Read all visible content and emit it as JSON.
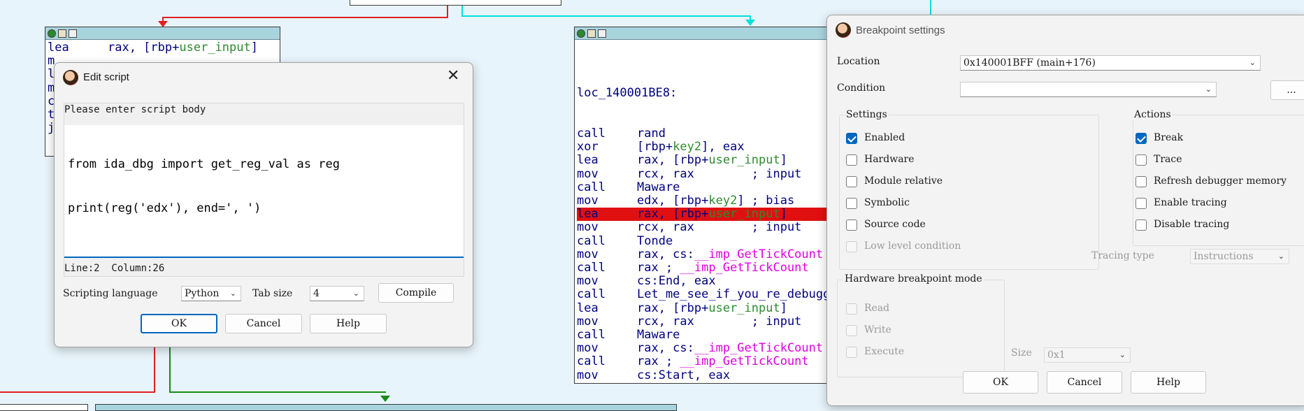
{
  "colors": {
    "background": "#e8f4fb",
    "highlight": "#e01010",
    "accent": "#0067c0",
    "edge_red": "#e02020",
    "edge_green": "#1a8a1a",
    "edge_cyan": "#00e0e0"
  },
  "left_node": {
    "lines": [
      {
        "mn": "lea",
        "ops": "rax, [rbp+",
        "kw": "user_input",
        "end": "]"
      },
      {
        "mn": "m",
        "ops": "",
        "kw": "",
        "end": ""
      },
      {
        "mn": "l",
        "ops": "",
        "kw": "",
        "end": ""
      },
      {
        "mn": "m",
        "ops": "",
        "kw": "",
        "end": ""
      },
      {
        "mn": "c",
        "ops": "",
        "kw": "",
        "end": ""
      },
      {
        "mn": "t",
        "ops": "",
        "kw": "",
        "end": ""
      },
      {
        "mn": "j",
        "ops": "",
        "kw": "",
        "end": ""
      }
    ]
  },
  "right_node": {
    "label": "loc_140001BE8:",
    "lines": [
      {
        "mn": "call",
        "a": "rand",
        "b": "",
        "c": "",
        "d": ""
      },
      {
        "mn": "xor",
        "a": "[rbp+",
        "b": "key2",
        "c": "], eax",
        "d": ""
      },
      {
        "mn": "lea",
        "a": "rax, [rbp+",
        "b": "user_input",
        "c": "]",
        "d": ""
      },
      {
        "mn": "mov",
        "a": "rcx, rax",
        "b": "",
        "c": "",
        "d": "        ; input"
      },
      {
        "mn": "call",
        "a": "Maware",
        "b": "",
        "c": "",
        "d": ""
      },
      {
        "mn": "mov",
        "a": "edx, [rbp+",
        "b": "key2",
        "c": "]",
        "d": " ; bias"
      },
      {
        "mn": "lea",
        "a": "rax, [rbp+",
        "b": "user_input",
        "c": "]",
        "d": ""
      },
      {
        "mn": "mov",
        "a": "rcx, rax",
        "b": "",
        "c": "",
        "d": "        ; input"
      },
      {
        "mn": "call",
        "a": "Tonde",
        "b": "",
        "c": "",
        "d": ""
      },
      {
        "mn": "mov",
        "a": "rax, cs:",
        "b": "__imp_GetTickCount",
        "c": "",
        "d": ""
      },
      {
        "mn": "call",
        "a": "rax ; ",
        "b": "__imp_GetTickCount",
        "c": "",
        "d": ""
      },
      {
        "mn": "mov",
        "a": "cs:End, eax",
        "b": "",
        "c": "",
        "d": ""
      },
      {
        "mn": "call",
        "a": "Let_me_see_if_you_re_debugging",
        "b": "",
        "c": "",
        "d": ""
      },
      {
        "mn": "lea",
        "a": "rax, [rbp+",
        "b": "user_input",
        "c": "]",
        "d": ""
      },
      {
        "mn": "mov",
        "a": "rcx, rax",
        "b": "",
        "c": "",
        "d": "        ; input"
      },
      {
        "mn": "call",
        "a": "Maware",
        "b": "",
        "c": "",
        "d": ""
      },
      {
        "mn": "mov",
        "a": "rax, cs:",
        "b": "__imp_GetTickCount",
        "c": "",
        "d": ""
      },
      {
        "mn": "call",
        "a": "rax ; ",
        "b": "__imp_GetTickCount",
        "c": "",
        "d": ""
      },
      {
        "mn": "mov",
        "a": "cs:Start, eax",
        "b": "",
        "c": "",
        "d": ""
      }
    ],
    "highlighted_index": 6
  },
  "edit_script": {
    "title": "Edit script",
    "prompt": "Please enter script body",
    "code_line1": "from ida_dbg import get_reg_val as reg",
    "code_line2": "print(reg('edx'), end=', ')",
    "status": "Line:2  Column:26",
    "lang_label": "Scripting language",
    "lang_value": "Python",
    "tab_label": "Tab size",
    "tab_value": "4",
    "compile": "Compile",
    "ok": "OK",
    "cancel": "Cancel",
    "help": "Help"
  },
  "bp": {
    "title": "Breakpoint settings",
    "location_label": "Location",
    "location_value": "0x140001BFF (main+176)",
    "condition_label": "Condition",
    "condition_value": "",
    "more": "...",
    "settings_title": "Settings",
    "settings": [
      {
        "label": "Enabled",
        "checked": true,
        "disabled": false
      },
      {
        "label": "Hardware",
        "checked": false,
        "disabled": false
      },
      {
        "label": "Module relative",
        "checked": false,
        "disabled": false
      },
      {
        "label": "Symbolic",
        "checked": false,
        "disabled": false
      },
      {
        "label": "Source code",
        "checked": false,
        "disabled": false
      },
      {
        "label": "Low level condition",
        "checked": false,
        "disabled": true
      }
    ],
    "actions_title": "Actions",
    "actions": [
      {
        "label": "Break",
        "checked": true
      },
      {
        "label": "Trace",
        "checked": false
      },
      {
        "label": "Refresh debugger memory",
        "checked": false
      },
      {
        "label": "Enable tracing",
        "checked": false
      },
      {
        "label": "Disable tracing",
        "checked": false
      }
    ],
    "tracing_type_label": "Tracing type",
    "tracing_type_value": "Instructions",
    "hw_title": "Hardware breakpoint mode",
    "hw_modes": [
      "Read",
      "Write",
      "Execute"
    ],
    "size_label": "Size",
    "size_value": "0x1",
    "ok": "OK",
    "cancel": "Cancel",
    "help": "Help"
  }
}
